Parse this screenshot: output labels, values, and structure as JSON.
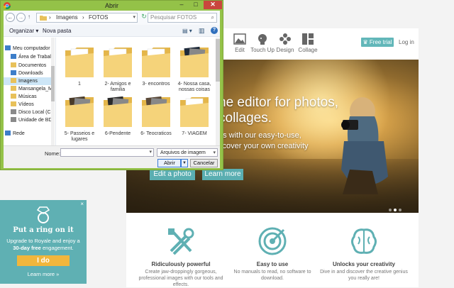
{
  "site": {
    "tools": [
      {
        "label": "Edit",
        "icon": "edit-photo-icon"
      },
      {
        "label": "Touch Up",
        "icon": "touch-up-face-icon"
      },
      {
        "label": "Design",
        "icon": "design-flower-icon"
      },
      {
        "label": "Collage",
        "icon": "collage-grid-icon"
      }
    ],
    "free_trial": "Free trial",
    "login": "Log in",
    "hero": {
      "headline_1": "he editor for photos,",
      "headline_2": "collages.",
      "sub_1": "es with our easy-to-use,",
      "sub_2": "scover your own creativity",
      "cta_edit": "Edit a photo",
      "cta_learn": "Learn more"
    },
    "features": [
      {
        "title": "Ridiculously powerful",
        "desc_1": "Create jaw-droppingly gorgeous,",
        "desc_2": "professional images with our tools and",
        "desc_3": "effects.",
        "icon": "tools-icon"
      },
      {
        "title": "Easy to use",
        "desc_1": "No manuals to read, no software to",
        "desc_2": "download.",
        "desc_3": "",
        "icon": "target-icon"
      },
      {
        "title": "Unlocks your creativity",
        "desc_1": "Dive in and discover the creative genius",
        "desc_2": "you really are!",
        "desc_3": "",
        "icon": "brain-icon"
      }
    ],
    "accent_color": "#5fb0b3"
  },
  "promo": {
    "close": "×",
    "title": "Put a ring on it",
    "text_1": "Upgrade to Royale and enjoy a",
    "text_bold": "30-day free",
    "text_2": " engagement.",
    "button": "I do",
    "more": "Learn more »",
    "button_color": "#f1b63c"
  },
  "dialog": {
    "title": "Abrir",
    "address": {
      "crumb_1": "Imagens",
      "sep": "›",
      "crumb_2": "FOTOS"
    },
    "search_placeholder": "Pesquisar FOTOS",
    "commands": {
      "organize": "Organizar ▾",
      "new_folder": "Nova pasta"
    },
    "nav_items": [
      {
        "label": "Meu computador",
        "icon": "computer-icon",
        "selected": false
      },
      {
        "label": "Área de Trabalh",
        "icon": "desktop-icon",
        "selected": false
      },
      {
        "label": "Documentos",
        "icon": "documents-icon",
        "selected": false
      },
      {
        "label": "Downloads",
        "icon": "downloads-icon",
        "selected": false
      },
      {
        "label": "Imagens",
        "icon": "pictures-icon",
        "selected": true
      },
      {
        "label": "Mansangela_Me",
        "icon": "user-folder-icon",
        "selected": false
      },
      {
        "label": "Músicas",
        "icon": "music-icon",
        "selected": false
      },
      {
        "label": "Vídeos",
        "icon": "videos-icon",
        "selected": false
      },
      {
        "label": "Disco Local (C:)",
        "icon": "drive-icon",
        "selected": false
      },
      {
        "label": "Unidade de BD-",
        "icon": "bd-drive-icon",
        "selected": false
      },
      {
        "label": "Rede",
        "icon": "network-icon",
        "selected": false
      }
    ],
    "files": [
      {
        "name_1": "1",
        "name_2": "",
        "thumb": "plain"
      },
      {
        "name_1": "2- Amigos e",
        "name_2": "familia",
        "thumb": "plain"
      },
      {
        "name_1": "3- encontros",
        "name_2": "",
        "thumb": "plain"
      },
      {
        "name_1": "4- Nossa casa,",
        "name_2": "nossas coisas",
        "thumb": "photo"
      },
      {
        "name_1": "5- Passeios e",
        "name_2": "lugares",
        "thumb": "photo"
      },
      {
        "name_1": "6-Pendente",
        "name_2": "",
        "thumb": "photo"
      },
      {
        "name_1": "6- Teocraticos",
        "name_2": "",
        "thumb": "photo"
      },
      {
        "name_1": "7- VIAGEM",
        "name_2": "",
        "thumb": "plain"
      }
    ],
    "filename_label": "Nome:",
    "filename_value": "",
    "filetype": "Arquivos de imagem",
    "open_button": "Abrir",
    "cancel_button": "Cancelar",
    "frame_color": "#94c248"
  }
}
